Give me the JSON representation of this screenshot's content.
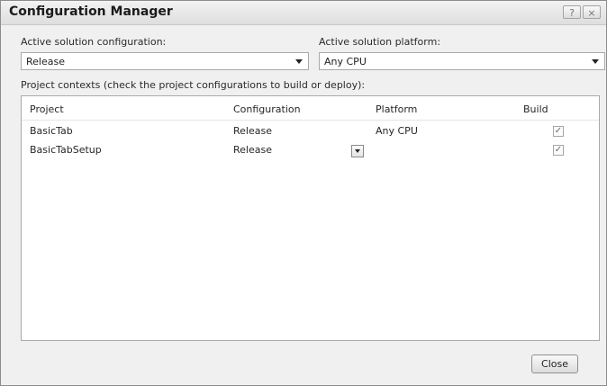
{
  "window": {
    "title": "Configuration Manager"
  },
  "titlebar_buttons": {
    "help": "?",
    "close": "×"
  },
  "solution_config": {
    "label": "Active solution configuration:",
    "value": "Release"
  },
  "solution_platform": {
    "label": "Active solution platform:",
    "value": "Any CPU"
  },
  "contexts_label": "Project contexts (check the project configurations to build or deploy):",
  "grid": {
    "headers": {
      "project": "Project",
      "configuration": "Configuration",
      "platform": "Platform",
      "build": "Build"
    },
    "rows": [
      {
        "project": "BasicTab",
        "configuration": "Release",
        "platform": "Any CPU",
        "build": true
      },
      {
        "project": "BasicTabSetup",
        "configuration": "Release",
        "platform": "",
        "build": true
      }
    ]
  },
  "checkmark": "✓",
  "close_button": "Close",
  "icons": {
    "dropdown": "chevron-down-icon",
    "help": "help-icon",
    "close": "close-icon",
    "checkbox": "checkbox-icon"
  }
}
